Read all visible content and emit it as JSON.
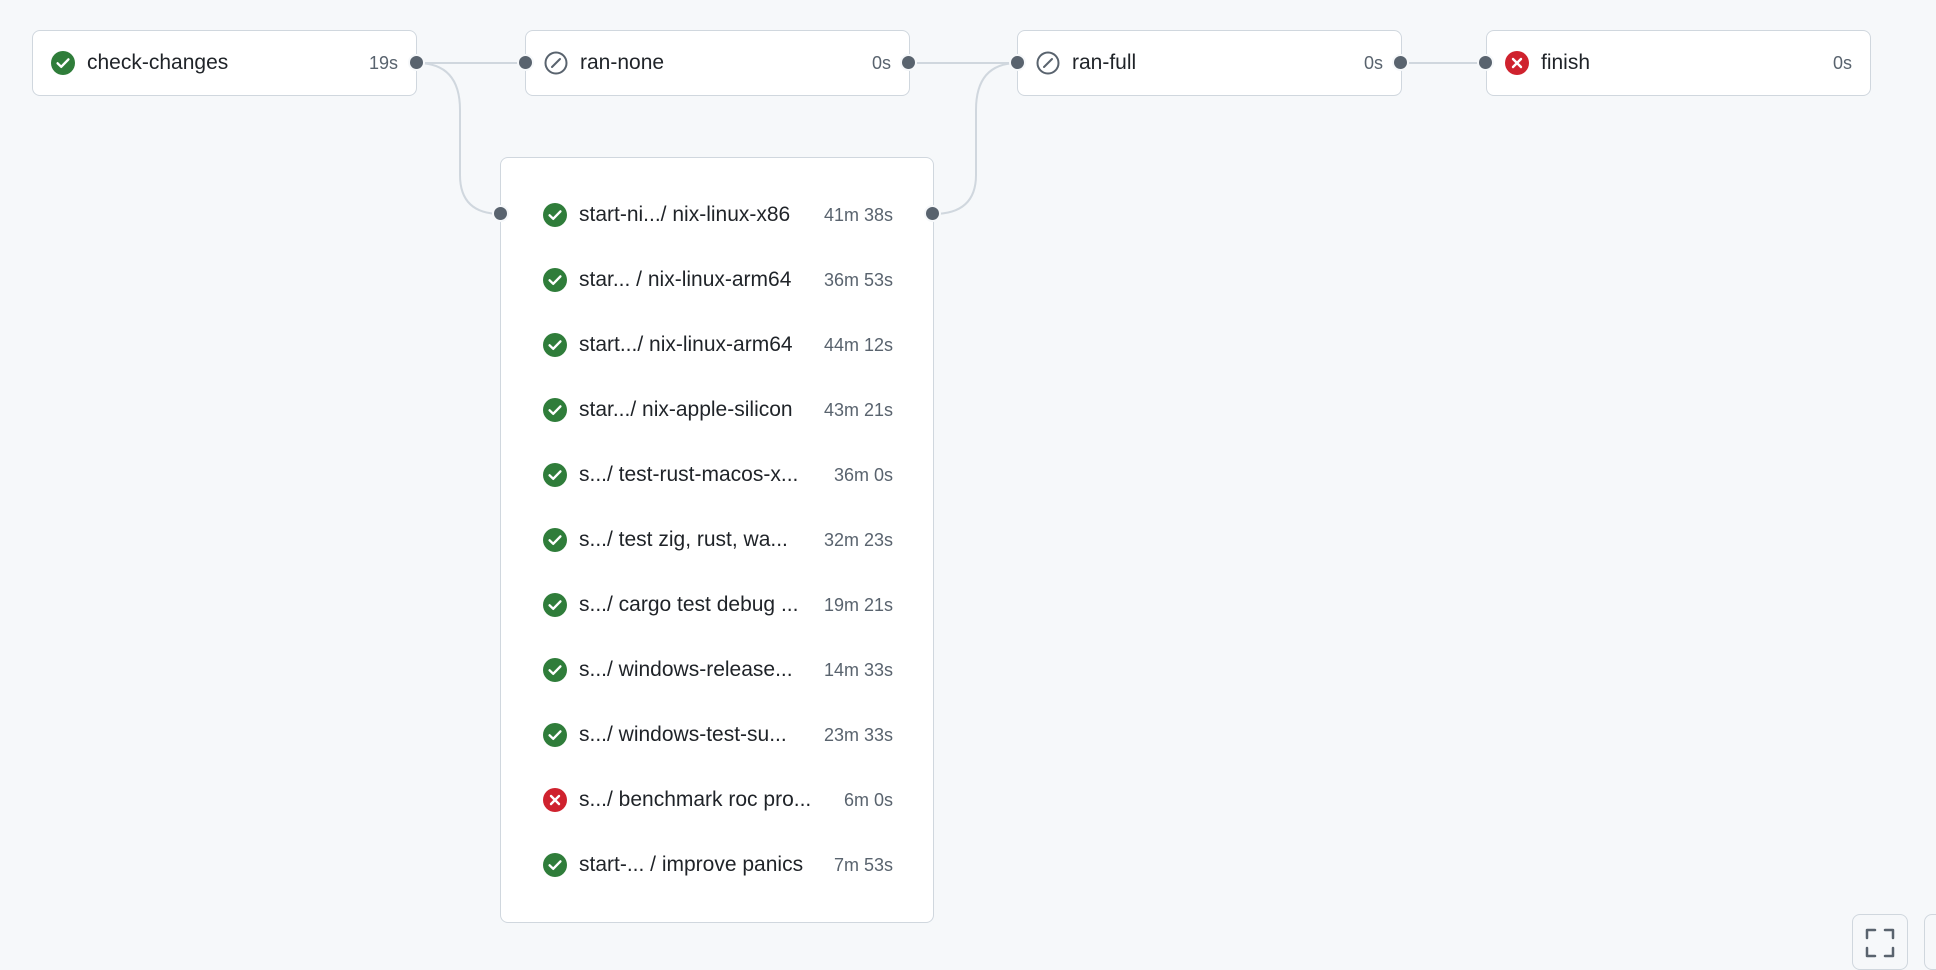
{
  "colors": {
    "success": "#2f7d3a",
    "failure": "#cf222e",
    "skipped": "#59636e",
    "connector": "#d0d7de"
  },
  "stages": [
    {
      "name": "check-changes",
      "duration": "19s",
      "status": "success",
      "icon": "check-circle-icon"
    },
    {
      "name": "ran-none",
      "duration": "0s",
      "status": "skipped",
      "icon": "skipped-icon"
    },
    {
      "name": "ran-full",
      "duration": "0s",
      "status": "skipped",
      "icon": "skipped-icon"
    },
    {
      "name": "finish",
      "duration": "0s",
      "status": "failure",
      "icon": "x-circle-icon"
    }
  ],
  "matrix_jobs": [
    {
      "name": "start-ni.../ nix-linux-x86",
      "duration": "41m 38s",
      "status": "success"
    },
    {
      "name": "star... / nix-linux-arm64",
      "duration": "36m 53s",
      "status": "success"
    },
    {
      "name": "start.../ nix-linux-arm64",
      "duration": "44m 12s",
      "status": "success"
    },
    {
      "name": "star.../ nix-apple-silicon",
      "duration": "43m 21s",
      "status": "success"
    },
    {
      "name": "s.../ test-rust-macos-x...",
      "duration": "36m 0s",
      "status": "success"
    },
    {
      "name": "s.../ test zig, rust, wa...",
      "duration": "32m 23s",
      "status": "success"
    },
    {
      "name": "s.../ cargo test debug ...",
      "duration": "19m 21s",
      "status": "success"
    },
    {
      "name": "s.../ windows-release...",
      "duration": "14m 33s",
      "status": "success"
    },
    {
      "name": "s.../ windows-test-su...",
      "duration": "23m 33s",
      "status": "success"
    },
    {
      "name": "s.../ benchmark roc pro...",
      "duration": "6m 0s",
      "status": "failure"
    },
    {
      "name": "start-...  / improve panics",
      "duration": "7m 53s",
      "status": "success"
    }
  ],
  "controls": {
    "fullscreen_icon": "fullscreen-icon"
  }
}
